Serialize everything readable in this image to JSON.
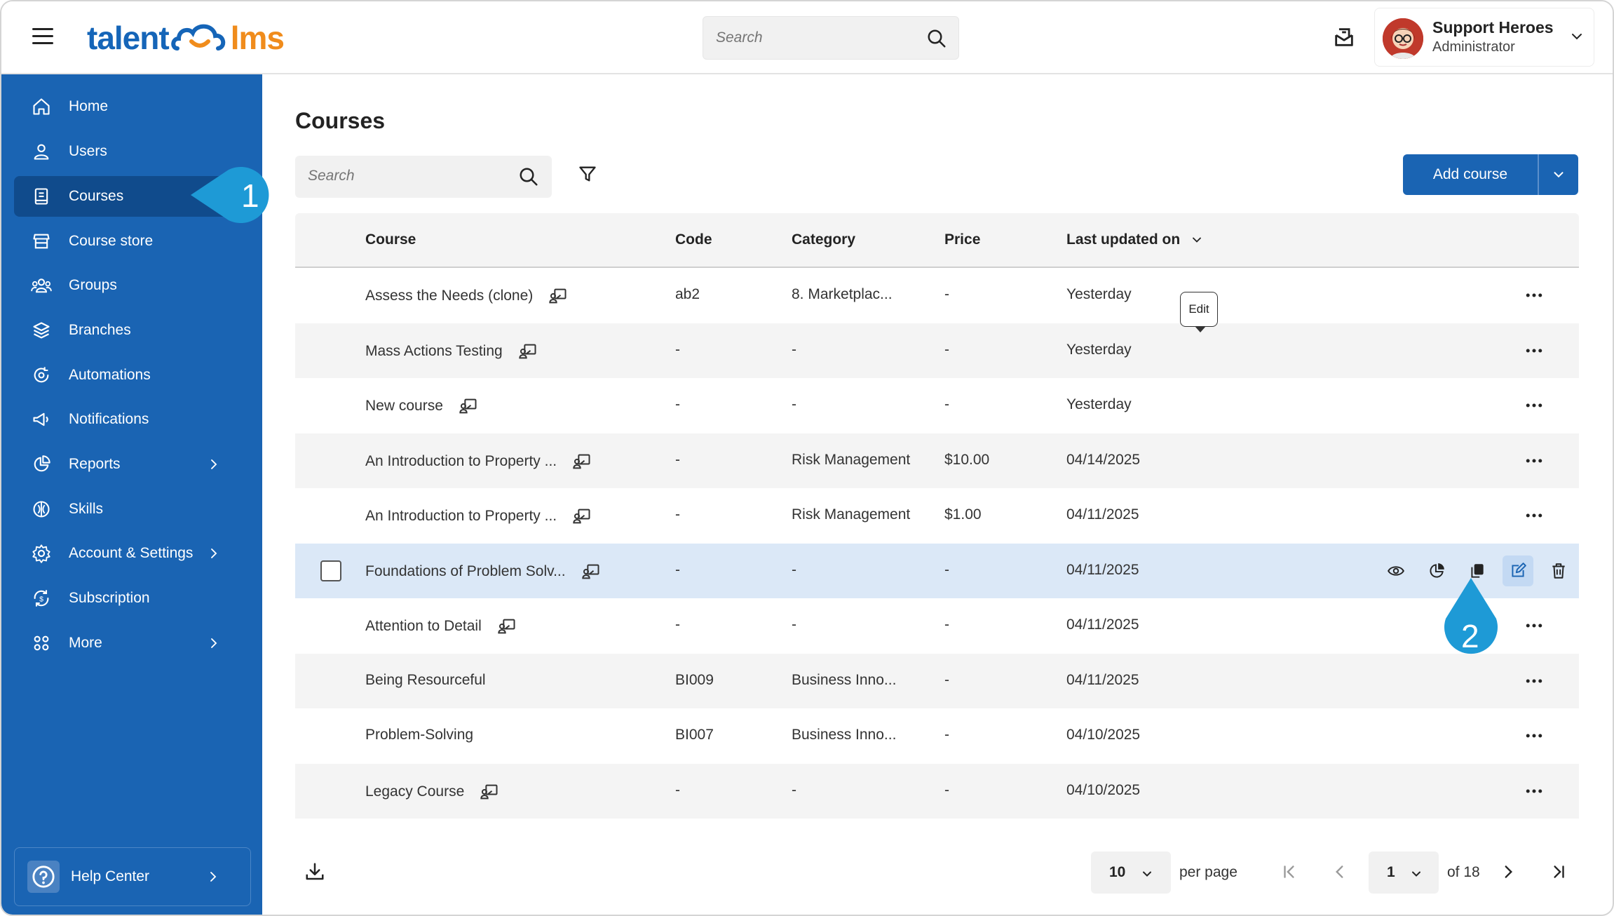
{
  "app": {
    "logo_left": "talent",
    "logo_right": "lms"
  },
  "header": {
    "search_placeholder": "Search",
    "user_name": "Support Heroes",
    "user_role": "Administrator"
  },
  "sidebar": {
    "items": [
      {
        "label": "Home",
        "icon": "home-icon"
      },
      {
        "label": "Users",
        "icon": "user-icon"
      },
      {
        "label": "Courses",
        "icon": "book-icon",
        "active": true
      },
      {
        "label": "Course store",
        "icon": "store-icon"
      },
      {
        "label": "Groups",
        "icon": "groups-icon"
      },
      {
        "label": "Branches",
        "icon": "branches-icon"
      },
      {
        "label": "Automations",
        "icon": "automations-icon"
      },
      {
        "label": "Notifications",
        "icon": "megaphone-icon"
      },
      {
        "label": "Reports",
        "icon": "pie-chart-icon"
      },
      {
        "label": "Skills",
        "icon": "skills-icon"
      },
      {
        "label": "Account & Settings",
        "icon": "gear-icon"
      },
      {
        "label": "Subscription",
        "icon": "subscription-icon"
      },
      {
        "label": "More",
        "icon": "grid-icon"
      }
    ],
    "help_center": "Help Center"
  },
  "callouts": {
    "one": "1",
    "two": "2"
  },
  "main": {
    "title": "Courses",
    "search_placeholder": "Search",
    "add_course_label": "Add course",
    "columns": [
      "Course",
      "Code",
      "Category",
      "Price",
      "Last updated on"
    ],
    "rows": [
      {
        "course": "Assess the Needs (clone)",
        "code": "ab2",
        "category": "8. Marketplac...",
        "price": "-",
        "updated": "Yesterday"
      },
      {
        "course": "Mass Actions Testing",
        "code": "-",
        "category": "-",
        "price": "-",
        "updated": "Yesterday"
      },
      {
        "course": "New course",
        "code": "-",
        "category": "-",
        "price": "-",
        "updated": "Yesterday"
      },
      {
        "course": "An Introduction to Property ...",
        "code": "-",
        "category": "Risk Management",
        "price": "$10.00",
        "updated": "04/14/2025"
      },
      {
        "course": "An Introduction to Property ...",
        "code": "-",
        "category": "Risk Management",
        "price": "$1.00",
        "updated": "04/11/2025"
      },
      {
        "course": "Foundations of Problem Solv...",
        "code": "-",
        "category": "-",
        "price": "-",
        "updated": "04/11/2025"
      },
      {
        "course": "Attention to Detail",
        "code": "-",
        "category": "-",
        "price": "-",
        "updated": "04/11/2025"
      },
      {
        "course": "Being Resourceful",
        "code": "BI009",
        "category": "Business Inno...",
        "price": "-",
        "updated": "04/11/2025"
      },
      {
        "course": "Problem-Solving",
        "code": "BI007",
        "category": "Business Inno...",
        "price": "-",
        "updated": "04/10/2025"
      },
      {
        "course": "Legacy Course",
        "code": "-",
        "category": "-",
        "price": "-",
        "updated": "04/10/2025"
      }
    ],
    "tooltip": "Edit"
  },
  "footer": {
    "per_page_value": "10",
    "per_page_label": "per page",
    "page_value": "1",
    "of_label": "of 18"
  },
  "colors": {
    "brand_blue": "#1a64b3",
    "accent_orange": "#f08c1c",
    "callout_blue": "#1e9ad6"
  }
}
